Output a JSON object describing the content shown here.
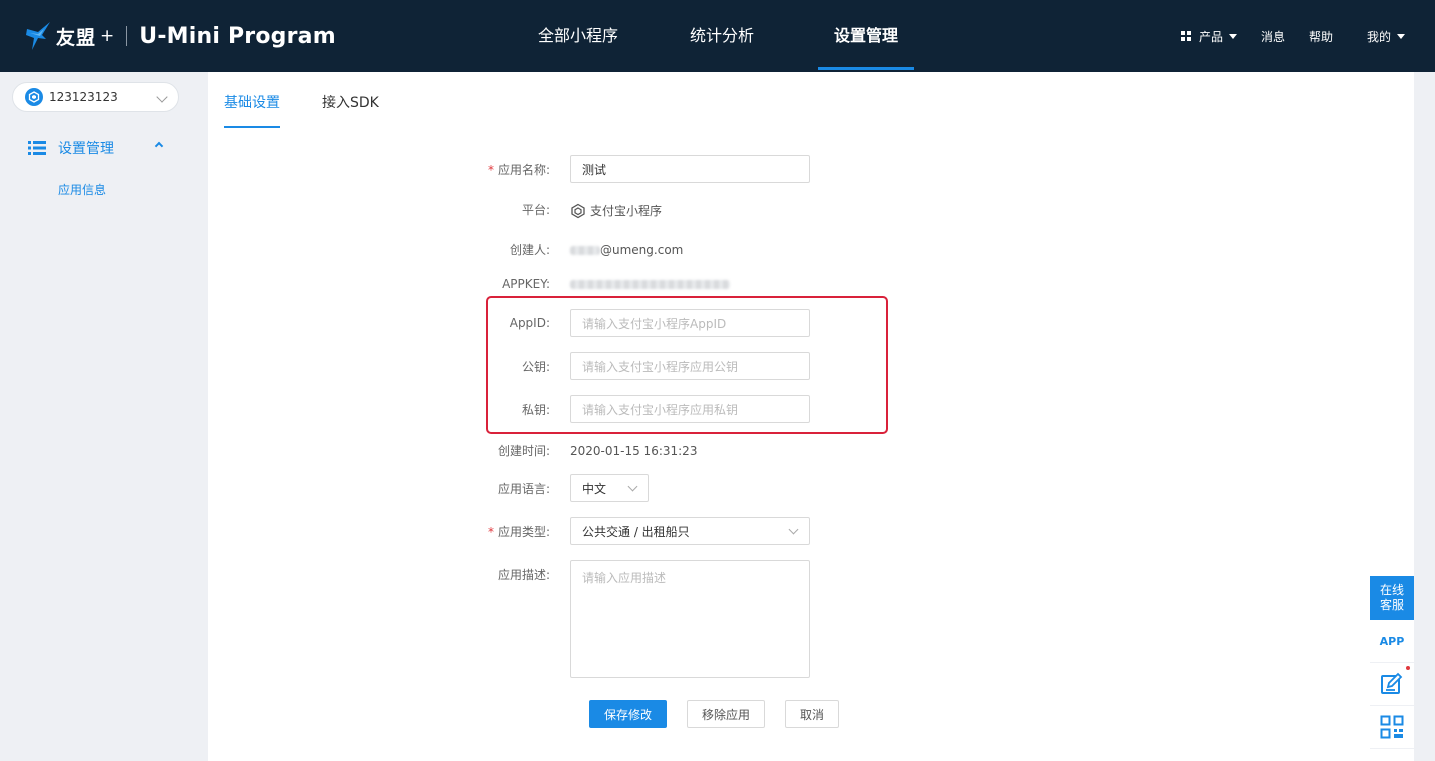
{
  "header": {
    "logo_cn": "友盟",
    "logo_plus": "+",
    "logo_en": "U-Mini Program",
    "nav": [
      {
        "label": "全部小程序",
        "active": false
      },
      {
        "label": "统计分析",
        "active": false
      },
      {
        "label": "设置管理",
        "active": true
      }
    ],
    "tools": {
      "product": "产品",
      "messages": "消息",
      "help": "帮助",
      "mine": "我的"
    }
  },
  "sidebar": {
    "app_selector": "123123123",
    "group_label": "设置管理",
    "items": [
      {
        "label": "应用信息"
      }
    ]
  },
  "tabs": [
    {
      "label": "基础设置",
      "active": true
    },
    {
      "label": "接入SDK",
      "active": false
    }
  ],
  "form": {
    "app_name": {
      "label": "应用名称:",
      "value": "测试",
      "required": true
    },
    "platform": {
      "label": "平台:",
      "value": "支付宝小程序",
      "icon": "alipay-miniapp-icon"
    },
    "creator": {
      "label": "创建人:",
      "value": "@umeng.com"
    },
    "appkey": {
      "label": "APPKEY:"
    },
    "appid": {
      "label": "AppID:",
      "placeholder": "请输入支付宝小程序AppID"
    },
    "public_key": {
      "label": "公钥:",
      "placeholder": "请输入支付宝小程序应用公钥"
    },
    "private_key": {
      "label": "私钥:",
      "placeholder": "请输入支付宝小程序应用私钥"
    },
    "created_at": {
      "label": "创建时间:",
      "value": "2020-01-15 16:31:23"
    },
    "language": {
      "label": "应用语言:",
      "value": "中文"
    },
    "app_type": {
      "label": "应用类型:",
      "value": "公共交通 / 出租船只",
      "required": true
    },
    "description": {
      "label": "应用描述:",
      "placeholder": "请输入应用描述"
    }
  },
  "buttons": {
    "save": "保存修改",
    "remove": "移除应用",
    "cancel": "取消"
  },
  "float_panel": {
    "online_service_line1": "在线",
    "online_service_line2": "客服",
    "app": "APP"
  },
  "colors": {
    "header_bg": "#0f2336",
    "accent": "#1a8ae5",
    "highlight_border": "#d9213a",
    "required_mark": "#e0393e"
  }
}
